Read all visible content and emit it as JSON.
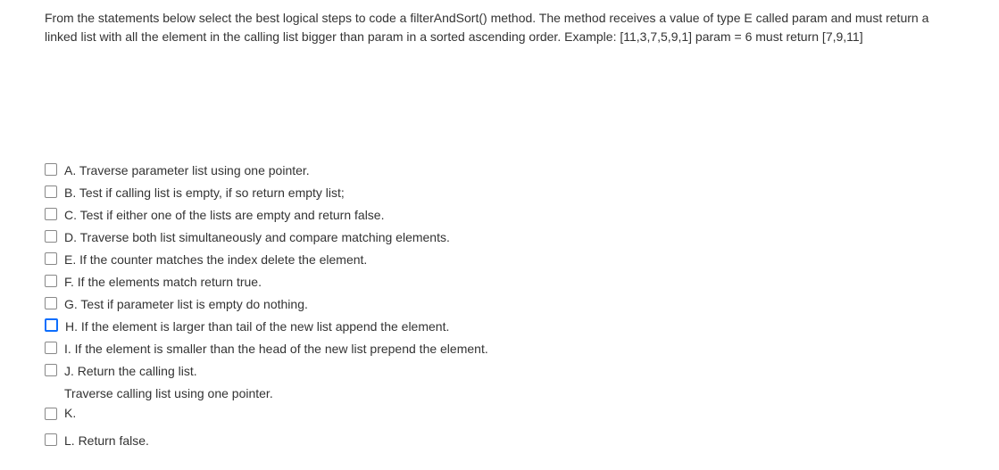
{
  "question": {
    "text": "From the statements below select the best logical steps to code a filterAndSort() method. The method receives a value of type E called param and must return a linked list with all the element in the calling list bigger than param in a sorted ascending order. Example: [11,3,7,5,9,1] param = 6 must return [7,9,11]"
  },
  "options": {
    "a": "A. Traverse parameter list using one pointer.",
    "b": "B. Test if calling list is empty, if so return empty list;",
    "c": "C. Test if either one of the lists are empty and return false.",
    "d": "D. Traverse both list simultaneously and compare matching elements.",
    "e": "E. If the counter matches the index delete the element.",
    "f": "F. If the elements match return true.",
    "g": "G. Test if parameter list is empty do nothing.",
    "h": "H. If the element is larger than tail of the new list append the element.",
    "i": "I. If the element is smaller than the head of the new list prepend the element.",
    "j": "J. Return the calling list.",
    "k_text": "Traverse calling list using one pointer.",
    "k": "K.",
    "l": "L. Return false."
  }
}
